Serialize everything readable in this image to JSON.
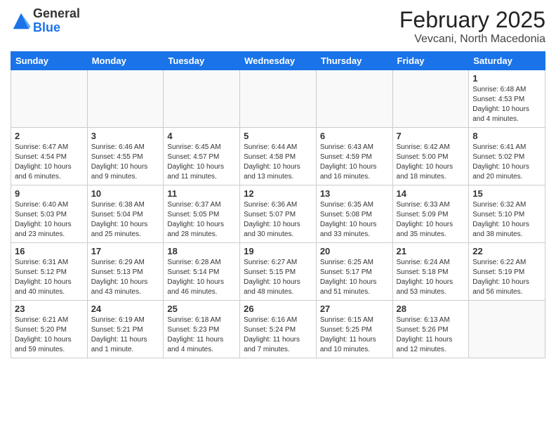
{
  "logo": {
    "general": "General",
    "blue": "Blue"
  },
  "header": {
    "title": "February 2025",
    "subtitle": "Vevcani, North Macedonia"
  },
  "weekdays": [
    "Sunday",
    "Monday",
    "Tuesday",
    "Wednesday",
    "Thursday",
    "Friday",
    "Saturday"
  ],
  "weeks": [
    [
      {
        "day": "",
        "info": ""
      },
      {
        "day": "",
        "info": ""
      },
      {
        "day": "",
        "info": ""
      },
      {
        "day": "",
        "info": ""
      },
      {
        "day": "",
        "info": ""
      },
      {
        "day": "",
        "info": ""
      },
      {
        "day": "1",
        "info": "Sunrise: 6:48 AM\nSunset: 4:53 PM\nDaylight: 10 hours and 4 minutes."
      }
    ],
    [
      {
        "day": "2",
        "info": "Sunrise: 6:47 AM\nSunset: 4:54 PM\nDaylight: 10 hours and 6 minutes."
      },
      {
        "day": "3",
        "info": "Sunrise: 6:46 AM\nSunset: 4:55 PM\nDaylight: 10 hours and 9 minutes."
      },
      {
        "day": "4",
        "info": "Sunrise: 6:45 AM\nSunset: 4:57 PM\nDaylight: 10 hours and 11 minutes."
      },
      {
        "day": "5",
        "info": "Sunrise: 6:44 AM\nSunset: 4:58 PM\nDaylight: 10 hours and 13 minutes."
      },
      {
        "day": "6",
        "info": "Sunrise: 6:43 AM\nSunset: 4:59 PM\nDaylight: 10 hours and 16 minutes."
      },
      {
        "day": "7",
        "info": "Sunrise: 6:42 AM\nSunset: 5:00 PM\nDaylight: 10 hours and 18 minutes."
      },
      {
        "day": "8",
        "info": "Sunrise: 6:41 AM\nSunset: 5:02 PM\nDaylight: 10 hours and 20 minutes."
      }
    ],
    [
      {
        "day": "9",
        "info": "Sunrise: 6:40 AM\nSunset: 5:03 PM\nDaylight: 10 hours and 23 minutes."
      },
      {
        "day": "10",
        "info": "Sunrise: 6:38 AM\nSunset: 5:04 PM\nDaylight: 10 hours and 25 minutes."
      },
      {
        "day": "11",
        "info": "Sunrise: 6:37 AM\nSunset: 5:05 PM\nDaylight: 10 hours and 28 minutes."
      },
      {
        "day": "12",
        "info": "Sunrise: 6:36 AM\nSunset: 5:07 PM\nDaylight: 10 hours and 30 minutes."
      },
      {
        "day": "13",
        "info": "Sunrise: 6:35 AM\nSunset: 5:08 PM\nDaylight: 10 hours and 33 minutes."
      },
      {
        "day": "14",
        "info": "Sunrise: 6:33 AM\nSunset: 5:09 PM\nDaylight: 10 hours and 35 minutes."
      },
      {
        "day": "15",
        "info": "Sunrise: 6:32 AM\nSunset: 5:10 PM\nDaylight: 10 hours and 38 minutes."
      }
    ],
    [
      {
        "day": "16",
        "info": "Sunrise: 6:31 AM\nSunset: 5:12 PM\nDaylight: 10 hours and 40 minutes."
      },
      {
        "day": "17",
        "info": "Sunrise: 6:29 AM\nSunset: 5:13 PM\nDaylight: 10 hours and 43 minutes."
      },
      {
        "day": "18",
        "info": "Sunrise: 6:28 AM\nSunset: 5:14 PM\nDaylight: 10 hours and 46 minutes."
      },
      {
        "day": "19",
        "info": "Sunrise: 6:27 AM\nSunset: 5:15 PM\nDaylight: 10 hours and 48 minutes."
      },
      {
        "day": "20",
        "info": "Sunrise: 6:25 AM\nSunset: 5:17 PM\nDaylight: 10 hours and 51 minutes."
      },
      {
        "day": "21",
        "info": "Sunrise: 6:24 AM\nSunset: 5:18 PM\nDaylight: 10 hours and 53 minutes."
      },
      {
        "day": "22",
        "info": "Sunrise: 6:22 AM\nSunset: 5:19 PM\nDaylight: 10 hours and 56 minutes."
      }
    ],
    [
      {
        "day": "23",
        "info": "Sunrise: 6:21 AM\nSunset: 5:20 PM\nDaylight: 10 hours and 59 minutes."
      },
      {
        "day": "24",
        "info": "Sunrise: 6:19 AM\nSunset: 5:21 PM\nDaylight: 11 hours and 1 minute."
      },
      {
        "day": "25",
        "info": "Sunrise: 6:18 AM\nSunset: 5:23 PM\nDaylight: 11 hours and 4 minutes."
      },
      {
        "day": "26",
        "info": "Sunrise: 6:16 AM\nSunset: 5:24 PM\nDaylight: 11 hours and 7 minutes."
      },
      {
        "day": "27",
        "info": "Sunrise: 6:15 AM\nSunset: 5:25 PM\nDaylight: 11 hours and 10 minutes."
      },
      {
        "day": "28",
        "info": "Sunrise: 6:13 AM\nSunset: 5:26 PM\nDaylight: 11 hours and 12 minutes."
      },
      {
        "day": "",
        "info": ""
      }
    ]
  ]
}
